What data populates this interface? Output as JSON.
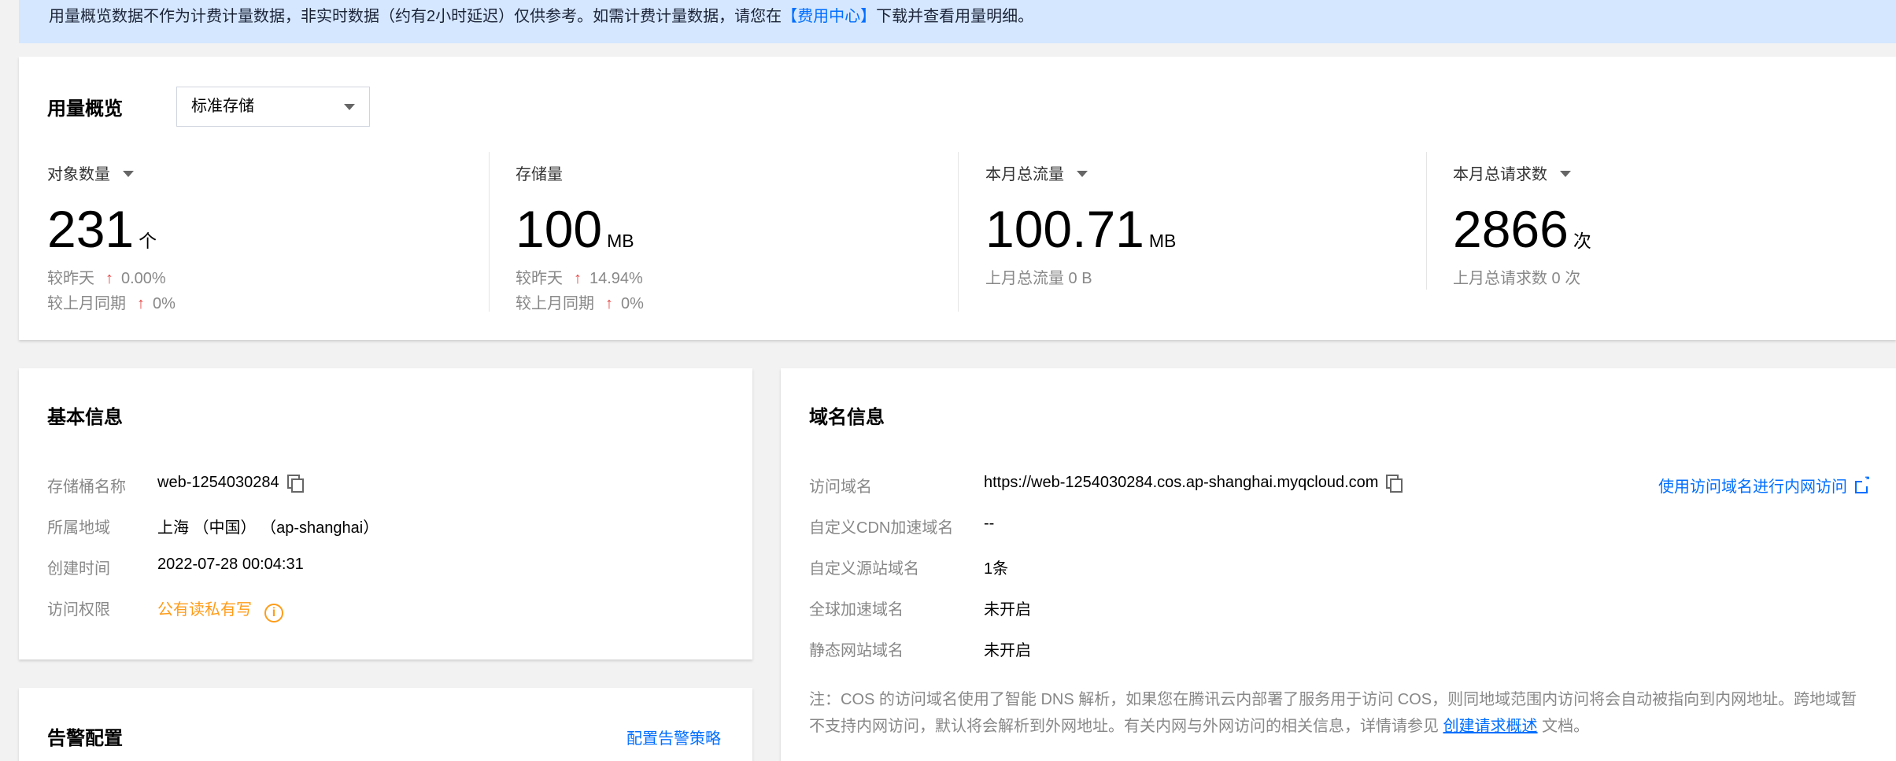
{
  "notice": {
    "text_before": "用量概览数据不作为计费计量数据，非实时数据（约有2小时延迟）仅供参考。如需计费计量数据，请您在",
    "link": "【费用中心】",
    "text_after": "下载并查看用量明细。"
  },
  "usage": {
    "title": "用量概览",
    "storage_class": "标准存储",
    "metrics": [
      {
        "label": "对象数量",
        "value": "231",
        "unit": "个",
        "sub1_label": "较昨天",
        "sub1_arrow": "↑",
        "sub1_value": "0.00%",
        "sub2_label": "较上月同期",
        "sub2_arrow": "↑",
        "sub2_value": "0%"
      },
      {
        "label": "存储量",
        "value": "100",
        "unit": "MB",
        "sub1_label": "较昨天",
        "sub1_arrow": "↑",
        "sub1_value": "14.94%",
        "sub2_label": "较上月同期",
        "sub2_arrow": "↑",
        "sub2_value": "0%"
      },
      {
        "label": "本月总流量",
        "value": "100.71",
        "unit": "MB",
        "sub1_text": "上月总流量 0 B"
      },
      {
        "label": "本月总请求数",
        "value": "2866",
        "unit": "次",
        "sub1_text": "上月总请求数 0 次"
      }
    ]
  },
  "basic": {
    "title": "基本信息",
    "bucket_label": "存储桶名称",
    "bucket_value": "web-1254030284",
    "region_label": "所属地域",
    "region_value": "上海 （中国） （ap-shanghai）",
    "created_label": "创建时间",
    "created_value": "2022-07-28 00:04:31",
    "access_label": "访问权限",
    "access_value": "公有读私有写",
    "info_glyph": "i"
  },
  "alarm": {
    "title": "告警配置",
    "config_link": "配置告警策略"
  },
  "domain": {
    "title": "域名信息",
    "access_label": "访问域名",
    "access_value": "https://web-1254030284.cos.ap-shanghai.myqcloud.com",
    "intranet_link": "使用访问域名进行内网访问",
    "cdn_label": "自定义CDN加速域名",
    "cdn_value": "--",
    "origin_label": "自定义源站域名",
    "origin_value": "1条",
    "global_label": "全球加速域名",
    "global_value": "未开启",
    "static_label": "静态网站域名",
    "static_value": "未开启",
    "note_before": "注：COS 的访问域名使用了智能 DNS 解析，如果您在腾讯云内部署了服务用于访问 COS，则同地域范围内访问将会自动被指向到内网地址。跨地域暂不支持内网访问，默认将会解析到外网地址。有关内网与外网访问的相关信息，详情请参见",
    "note_link": "创建请求概述",
    "note_after": "文档。"
  }
}
